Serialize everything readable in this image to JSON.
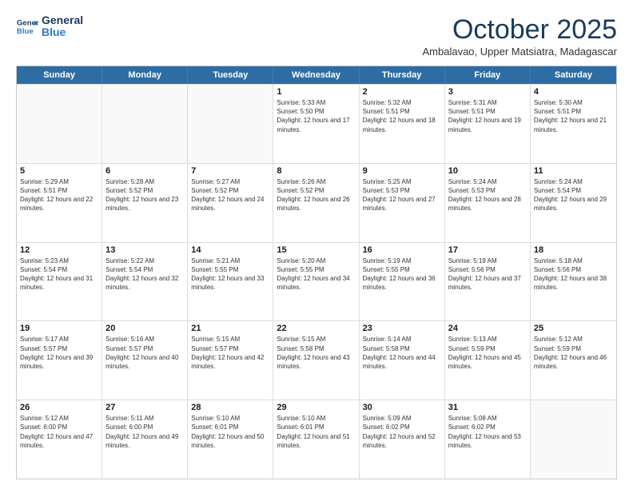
{
  "header": {
    "logo_general": "General",
    "logo_blue": "Blue",
    "month": "October 2025",
    "location": "Ambalavao, Upper Matsiatra, Madagascar"
  },
  "weekdays": [
    "Sunday",
    "Monday",
    "Tuesday",
    "Wednesday",
    "Thursday",
    "Friday",
    "Saturday"
  ],
  "rows": [
    [
      {
        "day": "",
        "sunrise": "",
        "sunset": "",
        "daylight": ""
      },
      {
        "day": "",
        "sunrise": "",
        "sunset": "",
        "daylight": ""
      },
      {
        "day": "",
        "sunrise": "",
        "sunset": "",
        "daylight": ""
      },
      {
        "day": "1",
        "sunrise": "Sunrise: 5:33 AM",
        "sunset": "Sunset: 5:50 PM",
        "daylight": "Daylight: 12 hours and 17 minutes."
      },
      {
        "day": "2",
        "sunrise": "Sunrise: 5:32 AM",
        "sunset": "Sunset: 5:51 PM",
        "daylight": "Daylight: 12 hours and 18 minutes."
      },
      {
        "day": "3",
        "sunrise": "Sunrise: 5:31 AM",
        "sunset": "Sunset: 5:51 PM",
        "daylight": "Daylight: 12 hours and 19 minutes."
      },
      {
        "day": "4",
        "sunrise": "Sunrise: 5:30 AM",
        "sunset": "Sunset: 5:51 PM",
        "daylight": "Daylight: 12 hours and 21 minutes."
      }
    ],
    [
      {
        "day": "5",
        "sunrise": "Sunrise: 5:29 AM",
        "sunset": "Sunset: 5:51 PM",
        "daylight": "Daylight: 12 hours and 22 minutes."
      },
      {
        "day": "6",
        "sunrise": "Sunrise: 5:28 AM",
        "sunset": "Sunset: 5:52 PM",
        "daylight": "Daylight: 12 hours and 23 minutes."
      },
      {
        "day": "7",
        "sunrise": "Sunrise: 5:27 AM",
        "sunset": "Sunset: 5:52 PM",
        "daylight": "Daylight: 12 hours and 24 minutes."
      },
      {
        "day": "8",
        "sunrise": "Sunrise: 5:26 AM",
        "sunset": "Sunset: 5:52 PM",
        "daylight": "Daylight: 12 hours and 26 minutes."
      },
      {
        "day": "9",
        "sunrise": "Sunrise: 5:25 AM",
        "sunset": "Sunset: 5:53 PM",
        "daylight": "Daylight: 12 hours and 27 minutes."
      },
      {
        "day": "10",
        "sunrise": "Sunrise: 5:24 AM",
        "sunset": "Sunset: 5:53 PM",
        "daylight": "Daylight: 12 hours and 28 minutes."
      },
      {
        "day": "11",
        "sunrise": "Sunrise: 5:24 AM",
        "sunset": "Sunset: 5:54 PM",
        "daylight": "Daylight: 12 hours and 29 minutes."
      }
    ],
    [
      {
        "day": "12",
        "sunrise": "Sunrise: 5:23 AM",
        "sunset": "Sunset: 5:54 PM",
        "daylight": "Daylight: 12 hours and 31 minutes."
      },
      {
        "day": "13",
        "sunrise": "Sunrise: 5:22 AM",
        "sunset": "Sunset: 5:54 PM",
        "daylight": "Daylight: 12 hours and 32 minutes."
      },
      {
        "day": "14",
        "sunrise": "Sunrise: 5:21 AM",
        "sunset": "Sunset: 5:55 PM",
        "daylight": "Daylight: 12 hours and 33 minutes."
      },
      {
        "day": "15",
        "sunrise": "Sunrise: 5:20 AM",
        "sunset": "Sunset: 5:55 PM",
        "daylight": "Daylight: 12 hours and 34 minutes."
      },
      {
        "day": "16",
        "sunrise": "Sunrise: 5:19 AM",
        "sunset": "Sunset: 5:55 PM",
        "daylight": "Daylight: 12 hours and 36 minutes."
      },
      {
        "day": "17",
        "sunrise": "Sunrise: 5:19 AM",
        "sunset": "Sunset: 5:56 PM",
        "daylight": "Daylight: 12 hours and 37 minutes."
      },
      {
        "day": "18",
        "sunrise": "Sunrise: 5:18 AM",
        "sunset": "Sunset: 5:56 PM",
        "daylight": "Daylight: 12 hours and 38 minutes."
      }
    ],
    [
      {
        "day": "19",
        "sunrise": "Sunrise: 5:17 AM",
        "sunset": "Sunset: 5:57 PM",
        "daylight": "Daylight: 12 hours and 39 minutes."
      },
      {
        "day": "20",
        "sunrise": "Sunrise: 5:16 AM",
        "sunset": "Sunset: 5:57 PM",
        "daylight": "Daylight: 12 hours and 40 minutes."
      },
      {
        "day": "21",
        "sunrise": "Sunrise: 5:15 AM",
        "sunset": "Sunset: 5:57 PM",
        "daylight": "Daylight: 12 hours and 42 minutes."
      },
      {
        "day": "22",
        "sunrise": "Sunrise: 5:15 AM",
        "sunset": "Sunset: 5:58 PM",
        "daylight": "Daylight: 12 hours and 43 minutes."
      },
      {
        "day": "23",
        "sunrise": "Sunrise: 5:14 AM",
        "sunset": "Sunset: 5:58 PM",
        "daylight": "Daylight: 12 hours and 44 minutes."
      },
      {
        "day": "24",
        "sunrise": "Sunrise: 5:13 AM",
        "sunset": "Sunset: 5:59 PM",
        "daylight": "Daylight: 12 hours and 45 minutes."
      },
      {
        "day": "25",
        "sunrise": "Sunrise: 5:12 AM",
        "sunset": "Sunset: 5:59 PM",
        "daylight": "Daylight: 12 hours and 46 minutes."
      }
    ],
    [
      {
        "day": "26",
        "sunrise": "Sunrise: 5:12 AM",
        "sunset": "Sunset: 6:00 PM",
        "daylight": "Daylight: 12 hours and 47 minutes."
      },
      {
        "day": "27",
        "sunrise": "Sunrise: 5:11 AM",
        "sunset": "Sunset: 6:00 PM",
        "daylight": "Daylight: 12 hours and 49 minutes."
      },
      {
        "day": "28",
        "sunrise": "Sunrise: 5:10 AM",
        "sunset": "Sunset: 6:01 PM",
        "daylight": "Daylight: 12 hours and 50 minutes."
      },
      {
        "day": "29",
        "sunrise": "Sunrise: 5:10 AM",
        "sunset": "Sunset: 6:01 PM",
        "daylight": "Daylight: 12 hours and 51 minutes."
      },
      {
        "day": "30",
        "sunrise": "Sunrise: 5:09 AM",
        "sunset": "Sunset: 6:02 PM",
        "daylight": "Daylight: 12 hours and 52 minutes."
      },
      {
        "day": "31",
        "sunrise": "Sunrise: 5:08 AM",
        "sunset": "Sunset: 6:02 PM",
        "daylight": "Daylight: 12 hours and 53 minutes."
      },
      {
        "day": "",
        "sunrise": "",
        "sunset": "",
        "daylight": ""
      }
    ]
  ]
}
